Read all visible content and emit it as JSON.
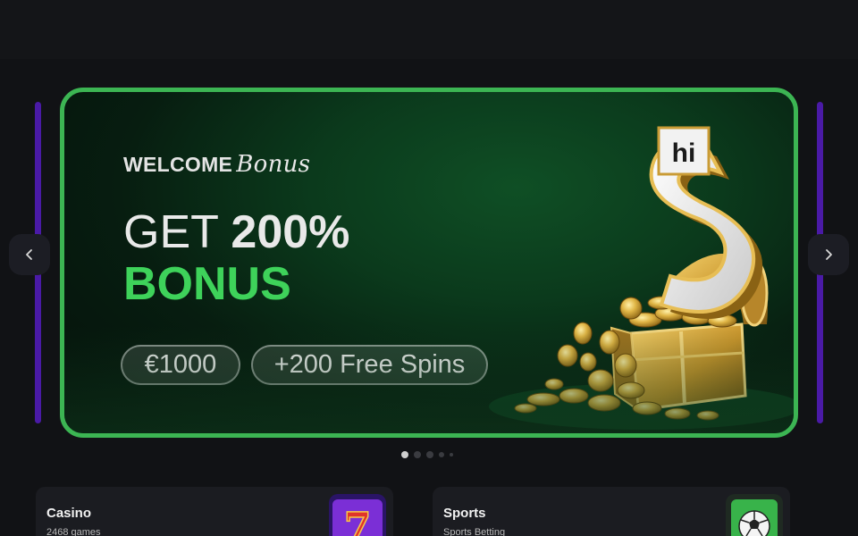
{
  "carousel": {
    "prev_icon": "chevron-left-icon",
    "next_icon": "chevron-right-icon",
    "slide_count": 5,
    "active_index": 0
  },
  "banner": {
    "welcome_prefix": "WELCOME",
    "welcome_script": "Bonus",
    "headline_prefix": "GET",
    "headline_value": "200%",
    "headline_line2": "BONUS",
    "amount_pill": "€1000",
    "spins_pill": "+200 Free Spins",
    "logo_text": "hi",
    "colors": {
      "border": "#3cb553",
      "accent": "#3ed25a"
    }
  },
  "categories": [
    {
      "title": "Casino",
      "subtitle": "2468 games",
      "icon": "slot-seven-icon"
    },
    {
      "title": "Sports",
      "subtitle": "Sports Betting",
      "icon": "soccer-ball-icon"
    }
  ]
}
